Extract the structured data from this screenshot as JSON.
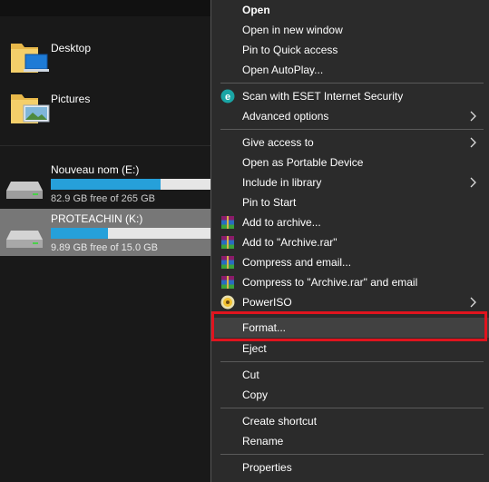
{
  "explorer": {
    "folders": [
      {
        "label": "Desktop",
        "icon": "desktop-folder-icon"
      },
      {
        "label": "Pictures",
        "icon": "pictures-folder-icon"
      }
    ],
    "drives": [
      {
        "name": "Nouveau nom (E:)",
        "free": "82.9 GB free of 265 GB",
        "used_fraction": 0.69,
        "selected": false
      },
      {
        "name": "PROTEACHIN (K:)",
        "free": "9.89 GB free of 15.0 GB",
        "used_fraction": 0.36,
        "selected": true
      }
    ]
  },
  "menu": {
    "open": "Open",
    "open_new_window": "Open in new window",
    "pin_quick_access": "Pin to Quick access",
    "open_autoplay": "Open AutoPlay...",
    "scan_eset": "Scan with ESET Internet Security",
    "advanced_options": "Advanced options",
    "give_access": "Give access to",
    "open_portable": "Open as Portable Device",
    "include_library": "Include in library",
    "pin_start": "Pin to Start",
    "add_archive": "Add to archive...",
    "add_archive_rar": "Add to \"Archive.rar\"",
    "compress_email": "Compress and email...",
    "compress_rar_email": "Compress to \"Archive.rar\" and email",
    "poweriso": "PowerISO",
    "format": "Format...",
    "eject": "Eject",
    "cut": "Cut",
    "copy": "Copy",
    "create_shortcut": "Create shortcut",
    "rename": "Rename",
    "properties": "Properties"
  },
  "colors": {
    "menu_bg": "#2b2b2b",
    "highlight_box": "#e0141e",
    "drive_bar_fill": "#26a0da",
    "selected_row": "#777777"
  }
}
